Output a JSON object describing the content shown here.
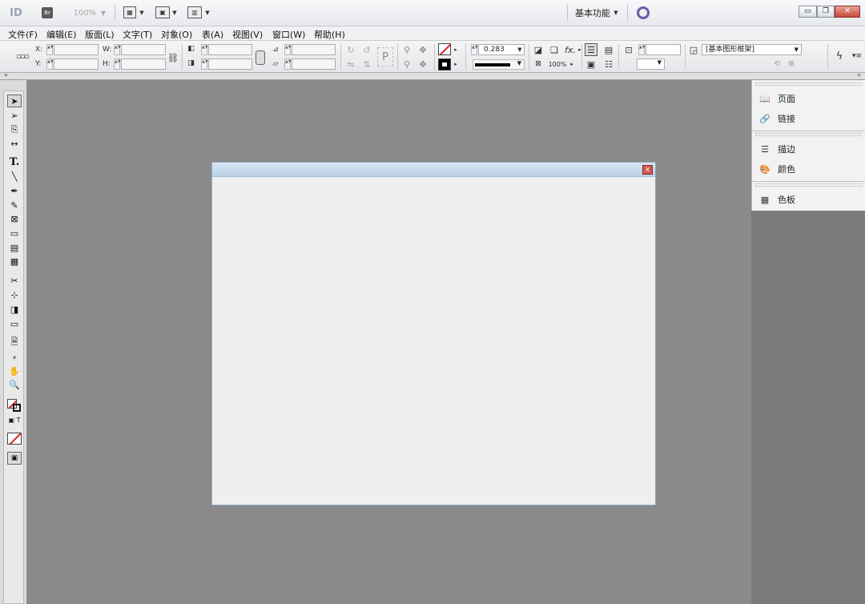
{
  "appbar": {
    "logo": "ID",
    "bridge": "Br",
    "zoom": "100%",
    "workspace": "基本功能",
    "win_minimize": "▭",
    "win_restore": "❐",
    "win_close": "✕"
  },
  "menu": {
    "items": [
      "文件(F)",
      "编辑(E)",
      "版面(L)",
      "文字(T)",
      "对象(O)",
      "表(A)",
      "视图(V)",
      "窗口(W)",
      "帮助(H)"
    ]
  },
  "control": {
    "x_label": "X:",
    "y_label": "Y:",
    "w_label": "W:",
    "h_label": "H:",
    "stroke_weight": "0.283",
    "opacity": "100%",
    "object_style": "[基本图形框架]",
    "fx": "fx."
  },
  "panels": {
    "items": [
      {
        "label": "页面",
        "icon": "pages-icon"
      },
      {
        "label": "链接",
        "icon": "links-icon"
      },
      {
        "label": "描边",
        "icon": "stroke-icon"
      },
      {
        "label": "颜色",
        "icon": "color-icon"
      },
      {
        "label": "色板",
        "icon": "swatches-icon"
      }
    ]
  },
  "tools": [
    "selection-tool",
    "direct-selection-tool",
    "page-tool",
    "gap-tool",
    "type-tool",
    "line-tool",
    "pen-tool",
    "pencil-tool",
    "rectangle-frame-tool",
    "rectangle-tool",
    "table-tool",
    "grid-tool",
    "scissors-tool",
    "free-transform-tool",
    "gradient-swatch-tool",
    "gradient-feather-tool",
    "note-tool",
    "eyedropper-tool",
    "hand-tool",
    "zoom-tool",
    "fill-stroke-swatch",
    "apply-none-button",
    "screen-mode-button"
  ],
  "dialog": {
    "close": "x"
  },
  "colors": {
    "pasteboard": "#8a8a8a",
    "accent": "#6f5aa8"
  }
}
